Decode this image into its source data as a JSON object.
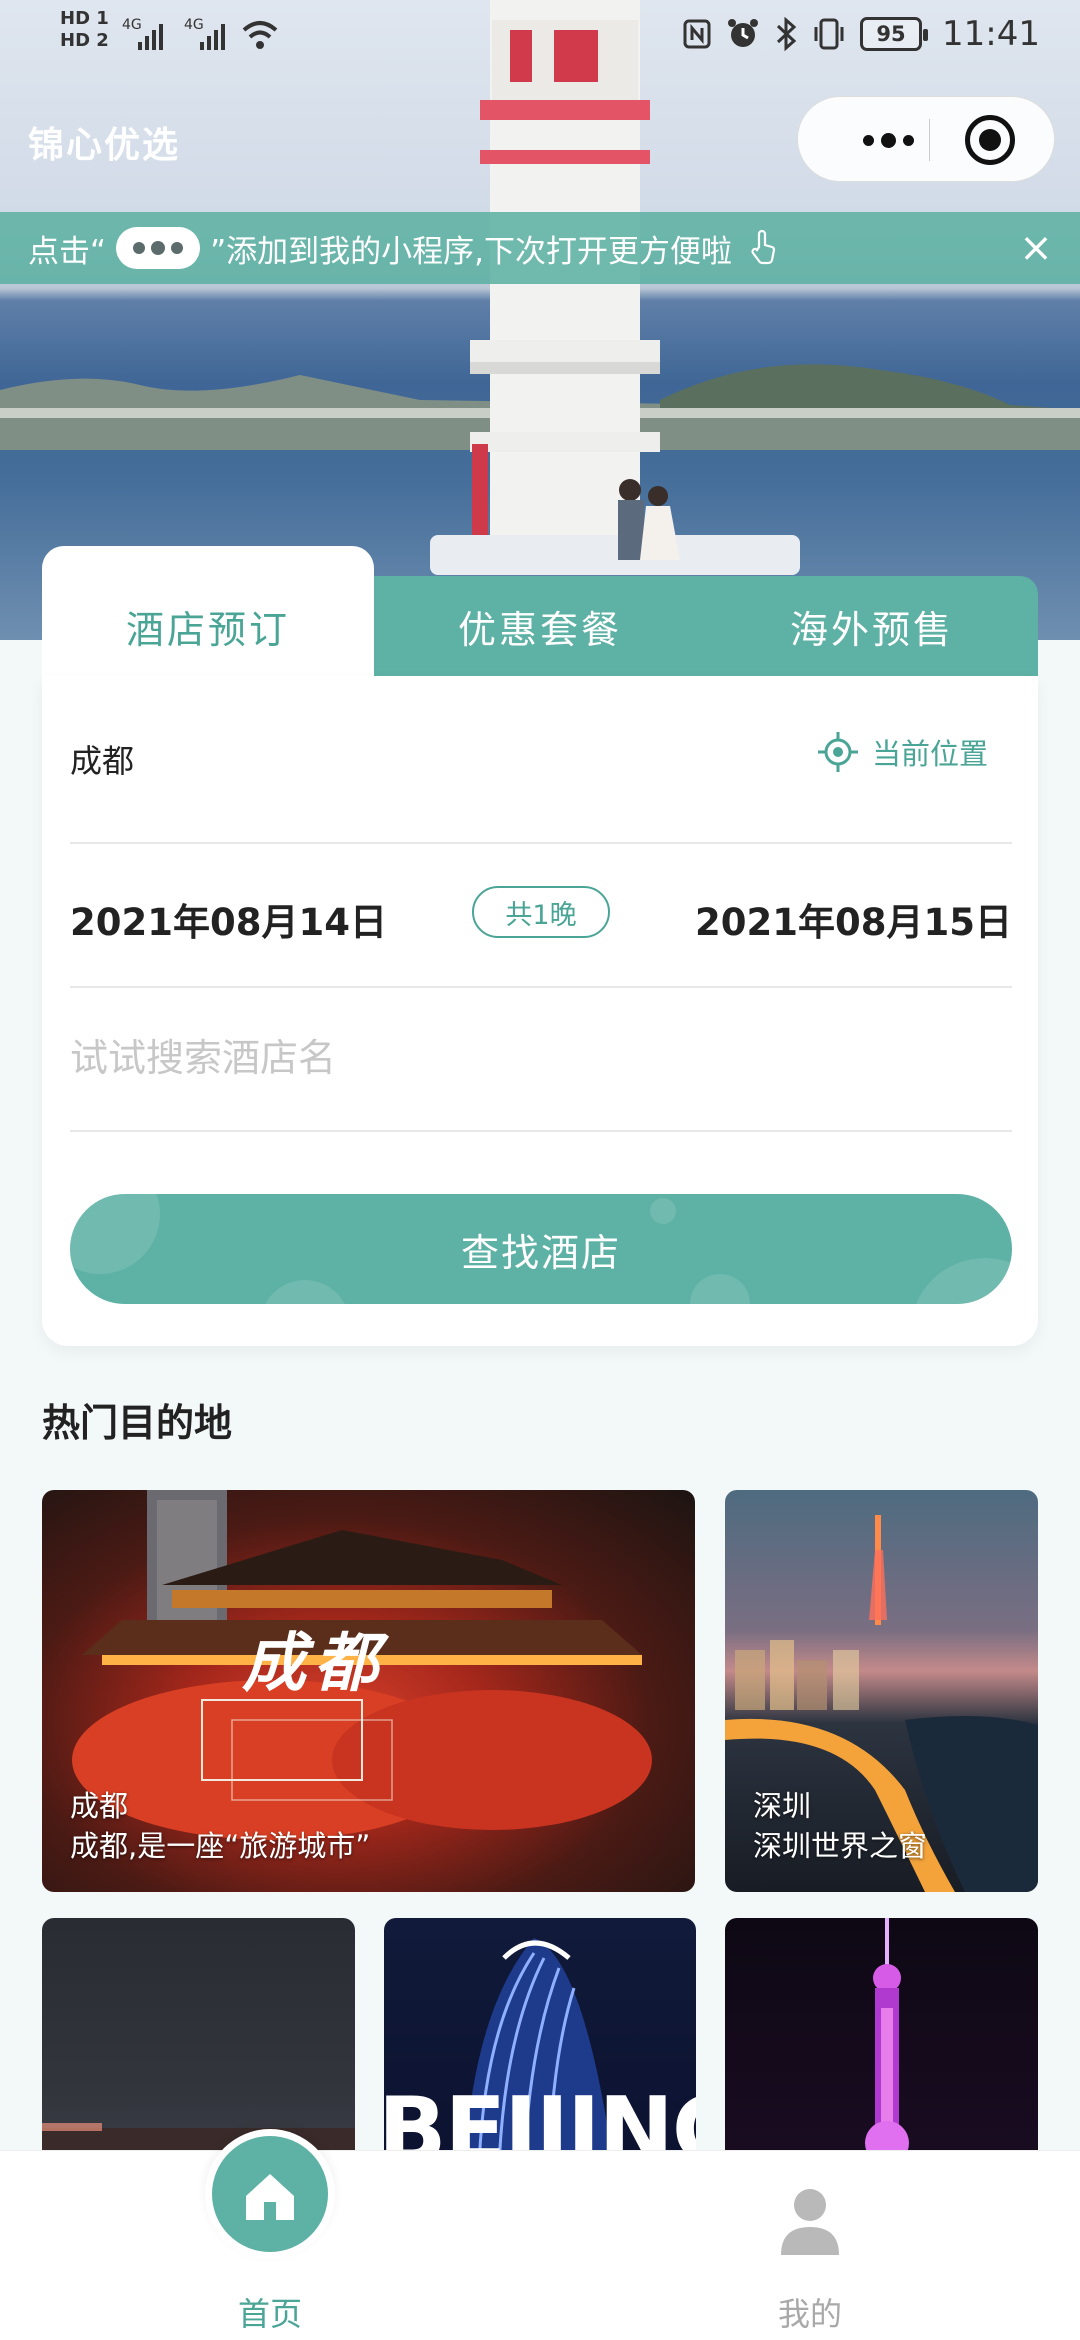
{
  "status_bar": {
    "time": "11:41",
    "battery": "95",
    "hd1": "HD 1",
    "hd2": "HD 2",
    "net1": "4G",
    "net2": "4G"
  },
  "header": {
    "app_title": "锦心优选"
  },
  "hint_bar": {
    "text_before": "点击“",
    "text_after": "”添加到我的小程序,下次打开更方便啦",
    "close": "×"
  },
  "booking": {
    "tabs": [
      {
        "label": "酒店预订",
        "active": true
      },
      {
        "label": "优惠套餐",
        "active": false
      },
      {
        "label": "海外预售",
        "active": false
      }
    ],
    "city": "成都",
    "current_location": "当前位置",
    "check_in": "2021年08月14日",
    "nights": "共1晚",
    "check_out": "2021年08月15日",
    "search_placeholder": "试试搜索酒店名",
    "search_button": "查找酒店"
  },
  "hot_destinations": {
    "title": "热门目的地",
    "items": [
      {
        "name": "成都",
        "desc": "成都,是一座“旅游城市”",
        "banner": "成都"
      },
      {
        "name": "深圳",
        "desc": "深圳世界之窗"
      },
      {
        "name": "",
        "desc": ""
      },
      {
        "name": "",
        "desc": "",
        "overlay": "BEIJING"
      },
      {
        "name": "",
        "desc": ""
      }
    ]
  },
  "tabbar": {
    "home": "首页",
    "me": "我的"
  },
  "colors": {
    "accent": "#5eb1a5",
    "accent_text": "#4aa596"
  }
}
